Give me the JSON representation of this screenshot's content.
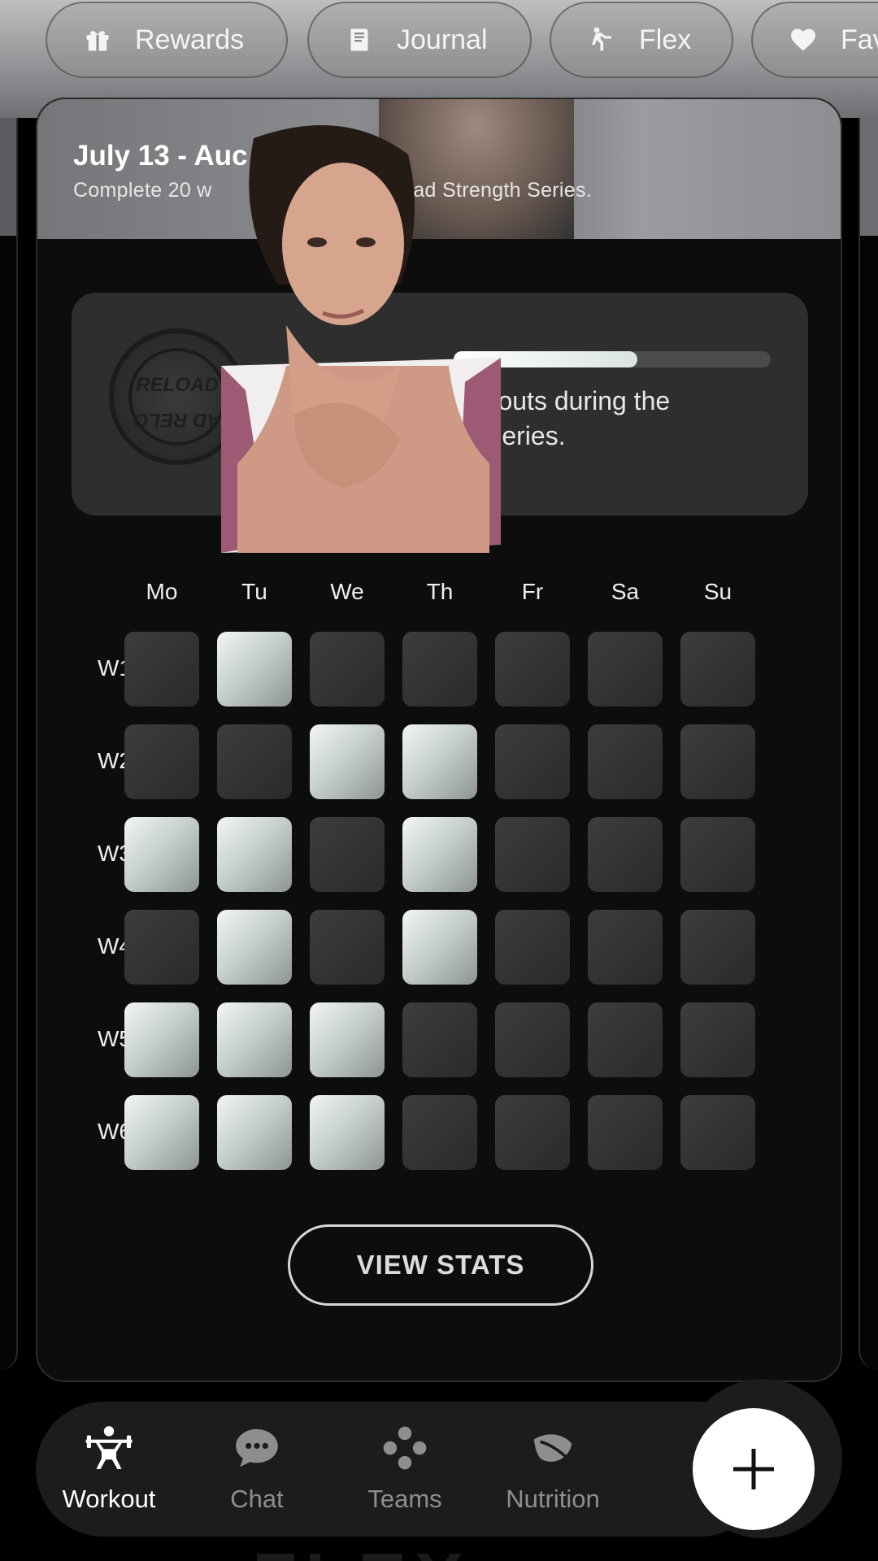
{
  "top_chips": [
    {
      "label": "Rewards",
      "icon": "gift-icon"
    },
    {
      "label": "Journal",
      "icon": "book-icon"
    },
    {
      "label": "Flex",
      "icon": "stretch-icon"
    },
    {
      "label": "Fav",
      "icon": "heart-icon"
    }
  ],
  "hero": {
    "title": "July 13 - Auc",
    "subtitle": "Complete 20 w                     the Reload Strength Series."
  },
  "challenge": {
    "badge_top": "RELOAD",
    "badge_bottom": "AD RELO",
    "progress_fraction": 0.58,
    "text_line1": "orkouts during the",
    "text_line2": "Series."
  },
  "days": [
    "Mo",
    "Tu",
    "We",
    "Th",
    "Fr",
    "Sa",
    "Su"
  ],
  "weeks": [
    {
      "label": "W1",
      "completed": [
        false,
        true,
        false,
        false,
        false,
        false,
        false
      ]
    },
    {
      "label": "W2",
      "completed": [
        false,
        false,
        true,
        true,
        false,
        false,
        false
      ]
    },
    {
      "label": "W3",
      "completed": [
        true,
        true,
        false,
        true,
        false,
        false,
        false
      ]
    },
    {
      "label": "W4",
      "completed": [
        false,
        true,
        false,
        true,
        false,
        false,
        false
      ]
    },
    {
      "label": "W5",
      "completed": [
        true,
        true,
        true,
        false,
        false,
        false,
        false
      ]
    },
    {
      "label": "W6",
      "completed": [
        true,
        true,
        true,
        false,
        false,
        false,
        false
      ]
    }
  ],
  "view_stats_label": "VIEW STATS",
  "nav": [
    {
      "label": "Workout",
      "icon": "weightlifter-icon",
      "active": true
    },
    {
      "label": "Chat",
      "icon": "chat-bubble-icon",
      "active": false
    },
    {
      "label": "Teams",
      "icon": "teams-dots-icon",
      "active": false
    },
    {
      "label": "Nutrition",
      "icon": "leaf-icon",
      "active": false
    }
  ],
  "fab_icon": "plus-icon",
  "footer_logo": "FLEX"
}
